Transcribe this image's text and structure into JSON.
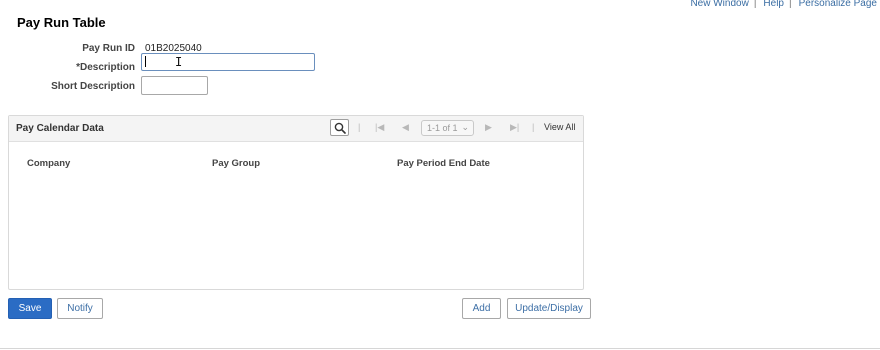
{
  "header_links": {
    "new_window": "New Window",
    "help": "Help",
    "personalize": "Personalize Page",
    "separator": "|"
  },
  "page": {
    "title": "Pay Run Table"
  },
  "form": {
    "pay_run_id_label": "Pay Run ID",
    "pay_run_id_value": "01B2025040",
    "description_label": "*Description",
    "description_value": "",
    "short_description_label": "Short Description",
    "short_description_value": ""
  },
  "grid": {
    "title": "Pay Calendar Data",
    "pager_text": "1-1 of 1",
    "view_all": "View All",
    "columns": [
      "Company",
      "Pay Group",
      "Pay Period End Date"
    ],
    "rows": []
  },
  "buttons": {
    "save": "Save",
    "notify": "Notify",
    "add": "Add",
    "update_display": "Update/Display"
  },
  "colors": {
    "primary_button": "#2b6cc4",
    "link": "#3a6da3"
  }
}
